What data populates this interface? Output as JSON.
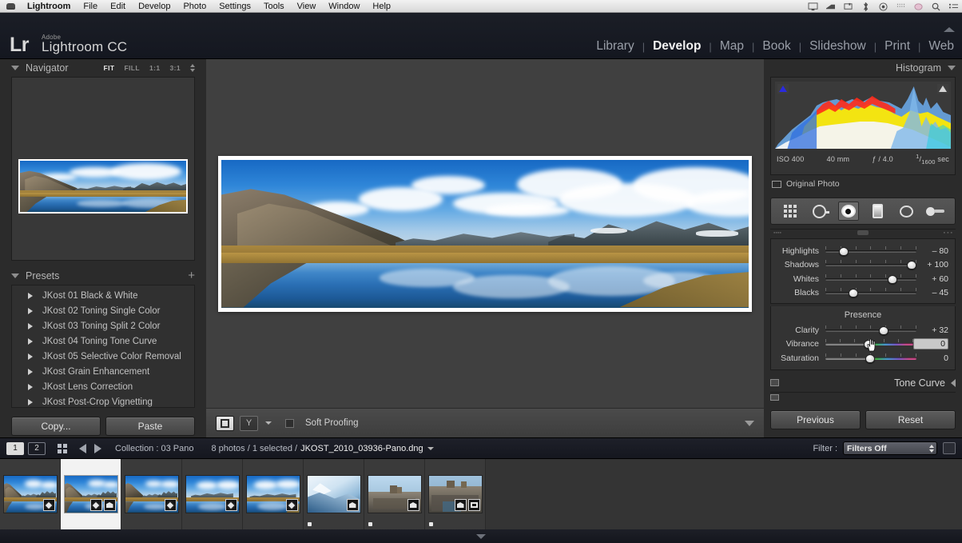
{
  "os_menu": {
    "apple_icon": "apple-logo-icon",
    "items": [
      "Lightroom",
      "File",
      "Edit",
      "Develop",
      "Photo",
      "Settings",
      "Tools",
      "View",
      "Window",
      "Help"
    ],
    "active_item": "Lightroom",
    "status_icons": [
      "screen-icon",
      "display-mirror-icon",
      "airplay-icon",
      "bluetooth-icon",
      "volume-icon",
      "wifi-icon",
      "battery-icon",
      "clock-icon",
      "spotlight-search-icon",
      "notification-center-icon"
    ]
  },
  "identity": {
    "logo": "Lr",
    "brand": "Adobe",
    "product": "Lightroom CC",
    "collapse_icon": "panel-collapse-arrow-icon"
  },
  "modules": {
    "items": [
      "Library",
      "Develop",
      "Map",
      "Book",
      "Slideshow",
      "Print",
      "Web"
    ],
    "active": "Develop",
    "separator": "|"
  },
  "navigator": {
    "title": "Navigator",
    "disclosure_icon": "triangle-down-icon",
    "zoom_levels": [
      "FIT",
      "FILL",
      "1:1",
      "3:1"
    ],
    "selected_zoom": "FIT",
    "stepper_icon": "up-down-stepper-icon"
  },
  "presets": {
    "title": "Presets",
    "disclosure_icon": "triangle-down-icon",
    "add_icon": "plus-icon",
    "items": [
      "JKost 01 Black & White",
      "JKost 02 Toning Single Color",
      "JKost 03 Toning Split 2 Color",
      "JKost 04 Toning Tone Curve",
      "JKost 05 Selective Color Removal",
      "JKost Grain Enhancement",
      "JKost Lens Correction",
      "JKost Post-Crop Vignetting"
    ]
  },
  "left_buttons": {
    "copy": "Copy...",
    "paste": "Paste"
  },
  "toolbar": {
    "view_icon": "loupe-view-icon",
    "flag_icons": [
      "flag-pick-icon",
      "flag-reject-icon"
    ],
    "dropdown_icon": "triangle-down-icon",
    "soft_proofing_label": "Soft Proofing",
    "soft_proofing_checked": false,
    "panel_toggle_icon": "triangle-down-icon"
  },
  "histogram": {
    "title": "Histogram",
    "disclosure_icon": "triangle-down-icon",
    "shadow_clip_icon": "shadow-clipping-icon",
    "highlight_clip_icon": "highlight-clipping-icon",
    "exif": {
      "iso": "ISO 400",
      "focal": "40 mm",
      "aperture": "ƒ / 4.0",
      "shutter_num": "1",
      "shutter_den": "1600",
      "shutter_unit": "sec"
    },
    "original_photo_label": "Original Photo",
    "original_photo_icon": "original-photo-swatch-icon"
  },
  "tools": {
    "items": [
      {
        "name": "crop-overlay-tool",
        "selected": false
      },
      {
        "name": "spot-removal-tool",
        "selected": false
      },
      {
        "name": "red-eye-correction-tool",
        "selected": true
      },
      {
        "name": "graduated-filter-tool",
        "selected": false
      },
      {
        "name": "radial-filter-tool",
        "selected": false
      },
      {
        "name": "adjustment-brush-tool",
        "selected": false
      }
    ]
  },
  "basic_panel": {
    "tone_sliders": [
      {
        "label": "Highlights",
        "value": "– 80",
        "pos": 20
      },
      {
        "label": "Shadows",
        "value": "+ 100",
        "pos": 95
      },
      {
        "label": "Whites",
        "value": "+ 60",
        "pos": 74
      },
      {
        "label": "Blacks",
        "value": "– 45",
        "pos": 31
      }
    ],
    "presence_title": "Presence",
    "presence_sliders": [
      {
        "label": "Clarity",
        "value": "+ 32",
        "pos": 64,
        "rainbow": false,
        "editing": false
      },
      {
        "label": "Vibrance",
        "value": "0",
        "pos": 49,
        "rainbow": true,
        "editing": true
      },
      {
        "label": "Saturation",
        "value": "0",
        "pos": 49,
        "rainbow": true,
        "editing": false
      }
    ],
    "cursor_icon": "hand-cursor-icon"
  },
  "tone_curve": {
    "title": "Tone Curve",
    "collapse_icon": "triangle-left-icon",
    "switch_icon": "panel-switch-icon"
  },
  "right_buttons": {
    "previous": "Previous",
    "reset": "Reset"
  },
  "filmstrip_bar": {
    "page_buttons": [
      "1",
      "2"
    ],
    "active_page": "1",
    "grid_icon": "grid-view-icon",
    "back_icon": "go-back-arrow-icon",
    "forward_icon": "go-forward-arrow-icon",
    "collection_label": "Collection : 03 Pano",
    "photo_count": "8 photos / 1 selected /",
    "filename": "JKOST_2010_03936-Pano.dng",
    "filename_dropdown_icon": "triangle-down-icon",
    "filter_label": "Filter :",
    "filter_value": "Filters Off",
    "filter_stepper_icon": "up-down-stepper-icon",
    "filter_end_icon": "filter-rating-icon"
  },
  "filmstrip": {
    "thumbnails": [
      {
        "id": "thumb-1",
        "selected": false,
        "scene": "lake-mountain",
        "badges": [
          "develop-badge"
        ],
        "dot": false
      },
      {
        "id": "thumb-2",
        "selected": true,
        "scene": "lake-mountain",
        "badges": [
          "develop-badge",
          "crop-badge"
        ],
        "dot": false
      },
      {
        "id": "thumb-3",
        "selected": false,
        "scene": "lake-mountain",
        "badges": [
          "develop-badge"
        ],
        "dot": false
      },
      {
        "id": "thumb-4",
        "selected": false,
        "scene": "lake-cloud",
        "badges": [
          "develop-badge"
        ],
        "dot": false
      },
      {
        "id": "thumb-5",
        "selected": false,
        "scene": "lake-cloud",
        "badges": [
          "develop-badge"
        ],
        "dot": false
      },
      {
        "id": "thumb-6",
        "selected": false,
        "scene": "ice-blue",
        "badges": [
          "crop-badge"
        ],
        "dot": true
      },
      {
        "id": "thumb-7",
        "selected": false,
        "scene": "rocky-ruin",
        "badges": [
          "crop-badge"
        ],
        "dot": true
      },
      {
        "id": "thumb-8",
        "selected": false,
        "scene": "rocky-ruin",
        "badges": [
          "crop-badge",
          "frame-badge"
        ],
        "dot": true
      }
    ]
  },
  "bottom_bar": {
    "toggle_icon": "triangle-up-icon"
  }
}
